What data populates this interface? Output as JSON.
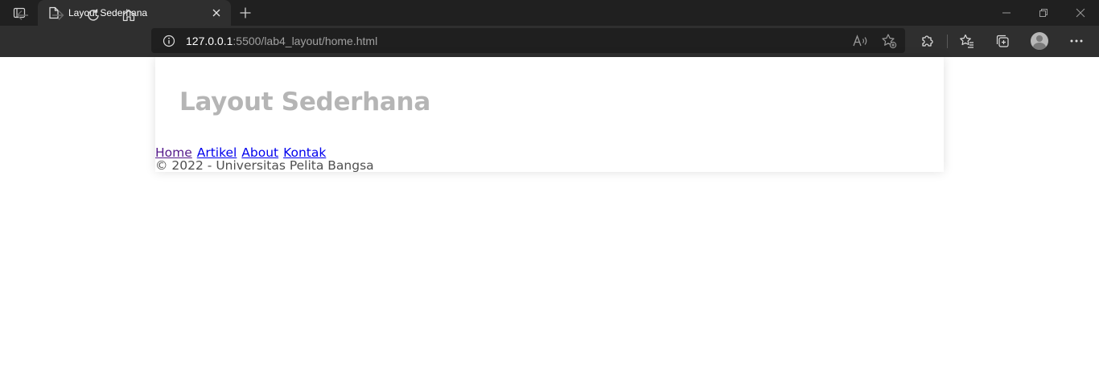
{
  "browser": {
    "tab_title": "Layout Sederhana",
    "address": {
      "host": "127.0.0.1",
      "rest": ":5500/lab4_layout/home.html"
    },
    "icons": {
      "tab_actions": "tab-actions-icon",
      "page": "page-icon",
      "tab_close": "close-icon",
      "new_tab": "plus-icon",
      "minimize": "minimize-icon",
      "restore": "restore-icon",
      "close_window": "close-icon",
      "back": "back-arrow-icon",
      "forward": "forward-arrow-icon",
      "refresh": "refresh-icon",
      "home": "home-icon",
      "site_info": "info-icon",
      "read_aloud": "read-aloud-icon",
      "add_favorite": "add-favorite-icon",
      "extensions": "puzzle-icon",
      "favorites": "favorites-icon",
      "collections": "collections-icon",
      "profile": "profile-avatar-icon",
      "menu": "more-icon"
    },
    "colors": {
      "tabbar_bg": "#202020",
      "toolbar_bg": "#2f2f2f",
      "address_bg": "#1f1f1f"
    }
  },
  "page": {
    "title": "Layout Sederhana",
    "nav": [
      {
        "label": "Home"
      },
      {
        "label": "Artikel"
      },
      {
        "label": "About"
      },
      {
        "label": "Kontak"
      }
    ],
    "footer": "© 2022 - Universitas Pelita Bangsa",
    "colors": {
      "title": "#b5b5b5",
      "link": "#0000ee",
      "visited_link": "#551a8b",
      "footer_text": "#505050"
    }
  }
}
